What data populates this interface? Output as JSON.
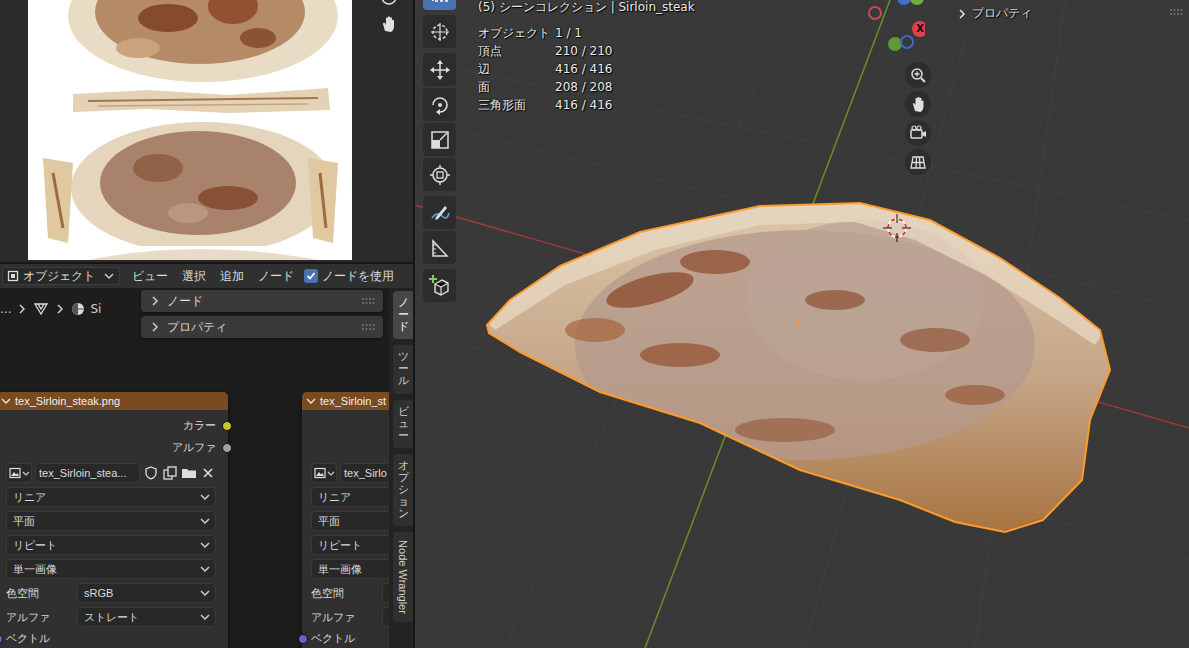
{
  "node_editor": {
    "header": {
      "mode": "オブジェクト",
      "menus": [
        "ビュー",
        "選択",
        "追加",
        "ノード"
      ],
      "use_nodes": {
        "label": "ノードを使用",
        "checked": true
      }
    },
    "breadcrumbs": [
      "...",
      "Si"
    ],
    "sidebar": {
      "panels": [
        {
          "label": "ノード",
          "expanded": false
        },
        {
          "label": "プロパティ",
          "expanded": false
        }
      ],
      "tabs": [
        {
          "label": "ノード",
          "selected": true
        },
        {
          "label": "ツール",
          "selected": false
        },
        {
          "label": "ビュー",
          "selected": false
        },
        {
          "label": "オプション",
          "selected": false
        },
        {
          "label": "Node Wrangler",
          "selected": false
        }
      ]
    },
    "nodes": [
      {
        "title": "tex_Sirloin_steak.png",
        "expanded": true,
        "outputs": [
          {
            "label": "カラー",
            "color": "#c7c729"
          },
          {
            "label": "アルファ",
            "color": "#a1a1a1"
          }
        ],
        "image_name": "tex_Sirloin_stea...",
        "dropdowns": [
          "リニア",
          "平面",
          "リピート",
          "単一画像"
        ],
        "settings": [
          {
            "label": "色空間",
            "value": "sRGB"
          },
          {
            "label": "アルファ",
            "value": "ストレート"
          }
        ],
        "input": {
          "label": "ベクトル",
          "color": "#6363c7"
        }
      },
      {
        "title": "tex_Sirloin_st",
        "expanded": true,
        "outputs": [],
        "image_name": "tex_Sirlo",
        "dropdowns": [
          "リニア",
          "平面",
          "リピート",
          "単一画像"
        ],
        "settings": [
          {
            "label": "色空間"
          },
          {
            "label": "アルファ"
          }
        ],
        "input": {
          "label": "ベクトル",
          "color": "#6363c7"
        }
      }
    ]
  },
  "viewport": {
    "title": "(5) シーンコレクション | Sirloin_steak",
    "stats": [
      {
        "label": "オブジェクト",
        "value": "1 / 1"
      },
      {
        "label": "頂点",
        "value": "210 / 210"
      },
      {
        "label": "辺",
        "value": "416 / 416"
      },
      {
        "label": "面",
        "value": "208 / 208"
      },
      {
        "label": "三角形面",
        "value": "416 / 416"
      }
    ],
    "properties": {
      "label": "プロパティ",
      "expanded": false
    },
    "gizmo": {
      "x_label": "X"
    },
    "toolbar": [
      {
        "selected": true
      },
      {
        "selected": false
      },
      {
        "selected": false
      },
      {
        "selected": false
      },
      {
        "selected": false
      },
      {
        "selected": false
      },
      {
        "selected": false
      },
      {
        "selected": false
      },
      {
        "selected": false
      }
    ]
  }
}
